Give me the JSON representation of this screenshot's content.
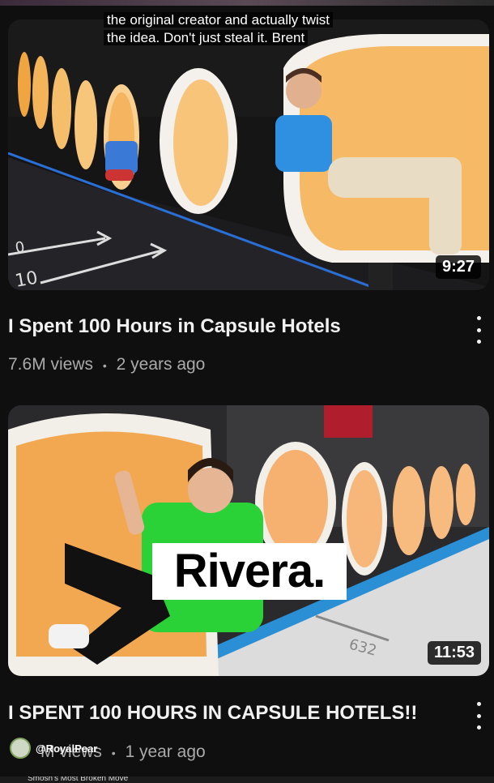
{
  "videos": [
    {
      "title": "I Spent 100 Hours in Capsule Hotels",
      "views": "7.6M views",
      "separator": "•",
      "age": "2 years ago",
      "duration": "9:27",
      "caption_line1": "the original creator and actually twist",
      "caption_line2": "the idea. Don't just steal it. Brent"
    },
    {
      "title": "I SPENT 100 HOURS IN CAPSULE HOTELS!!",
      "views": "M views",
      "separator": "•",
      "age": "1 year ago",
      "duration": "11:53",
      "big_caption": "Rivera."
    }
  ],
  "creator_handle": "@RoyalPear",
  "bottom_text": "Smosh's Most Broken Move"
}
